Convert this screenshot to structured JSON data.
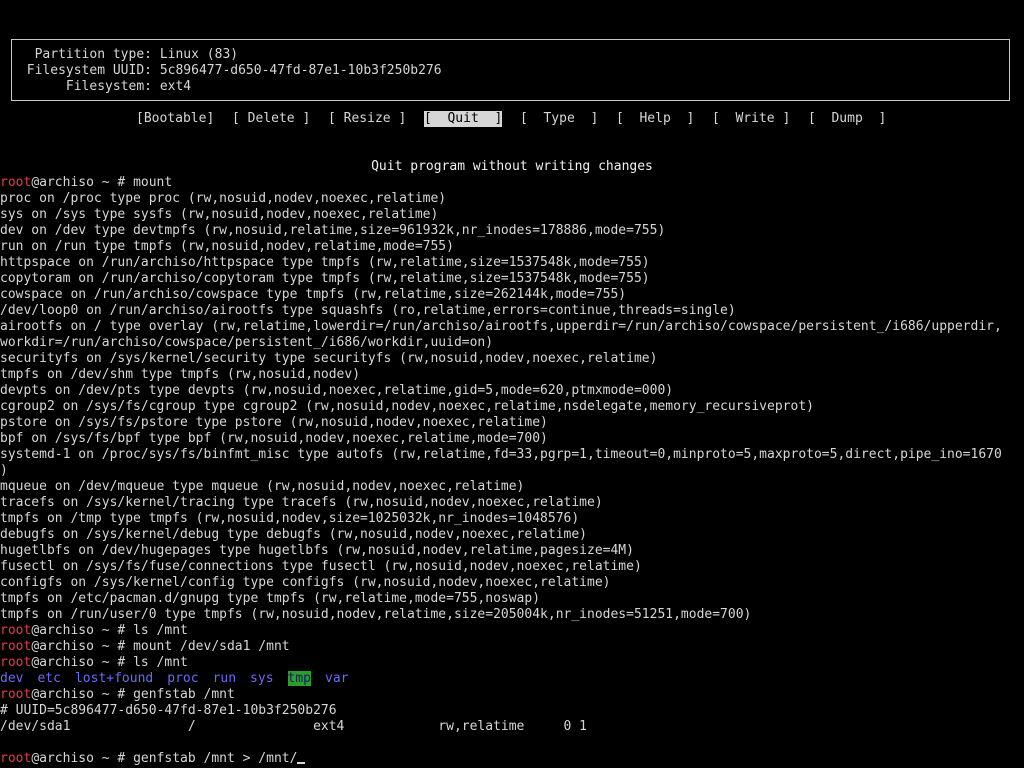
{
  "partition_info": {
    "type_label": "Partition type:",
    "type_value": "Linux (83)",
    "uuid_label": "Filesystem UUID:",
    "uuid_value": "5c896477-d650-47fd-87e1-10b3f250b276",
    "fs_label": "Filesystem:",
    "fs_value": "ext4"
  },
  "menu": {
    "bootable": "[Bootable]",
    "delete": "[ Delete ]",
    "resize": "[ Resize ]",
    "quit": "[  Quit  ]",
    "type": "[  Type  ]",
    "help": "[  Help  ]",
    "write": "[  Write ]",
    "dump": "[  Dump  ]",
    "selected": "quit"
  },
  "hint_text": "Quit program without writing changes",
  "prompt": {
    "user": "root",
    "rest": "@archiso ~ # "
  },
  "console": {
    "cmd_mount": "mount",
    "mount_output": [
      "proc on /proc type proc (rw,nosuid,nodev,noexec,relatime)",
      "sys on /sys type sysfs (rw,nosuid,nodev,noexec,relatime)",
      "dev on /dev type devtmpfs (rw,nosuid,relatime,size=961932k,nr_inodes=178886,mode=755)",
      "run on /run type tmpfs (rw,nosuid,nodev,relatime,mode=755)",
      "httpspace on /run/archiso/httpspace type tmpfs (rw,relatime,size=1537548k,mode=755)",
      "copytoram on /run/archiso/copytoram type tmpfs (rw,relatime,size=1537548k,mode=755)",
      "cowspace on /run/archiso/cowspace type tmpfs (rw,relatime,size=262144k,mode=755)",
      "/dev/loop0 on /run/archiso/airootfs type squashfs (ro,relatime,errors=continue,threads=single)",
      "airootfs on / type overlay (rw,relatime,lowerdir=/run/archiso/airootfs,upperdir=/run/archiso/cowspace/persistent_/i686/upperdir,",
      "workdir=/run/archiso/cowspace/persistent_/i686/workdir,uuid=on)",
      "securityfs on /sys/kernel/security type securityfs (rw,nosuid,nodev,noexec,relatime)",
      "tmpfs on /dev/shm type tmpfs (rw,nosuid,nodev)",
      "devpts on /dev/pts type devpts (rw,nosuid,noexec,relatime,gid=5,mode=620,ptmxmode=000)",
      "cgroup2 on /sys/fs/cgroup type cgroup2 (rw,nosuid,nodev,noexec,relatime,nsdelegate,memory_recursiveprot)",
      "pstore on /sys/fs/pstore type pstore (rw,nosuid,nodev,noexec,relatime)",
      "bpf on /sys/fs/bpf type bpf (rw,nosuid,nodev,noexec,relatime,mode=700)",
      "systemd-1 on /proc/sys/fs/binfmt_misc type autofs (rw,relatime,fd=33,pgrp=1,timeout=0,minproto=5,maxproto=5,direct,pipe_ino=1670",
      ")",
      "mqueue on /dev/mqueue type mqueue (rw,nosuid,nodev,noexec,relatime)",
      "tracefs on /sys/kernel/tracing type tracefs (rw,nosuid,nodev,noexec,relatime)",
      "tmpfs on /tmp type tmpfs (rw,nosuid,nodev,size=1025032k,nr_inodes=1048576)",
      "debugfs on /sys/kernel/debug type debugfs (rw,nosuid,nodev,noexec,relatime)",
      "hugetlbfs on /dev/hugepages type hugetlbfs (rw,nosuid,nodev,relatime,pagesize=4M)",
      "fusectl on /sys/fs/fuse/connections type fusectl (rw,nosuid,nodev,noexec,relatime)",
      "configfs on /sys/kernel/config type configfs (rw,nosuid,nodev,noexec,relatime)",
      "tmpfs on /etc/pacman.d/gnupg type tmpfs (rw,relatime,mode=755,noswap)",
      "tmpfs on /run/user/0 type tmpfs (rw,nosuid,nodev,relatime,size=205004k,nr_inodes=51251,mode=700)"
    ],
    "cmd_ls1": "ls /mnt",
    "cmd_mount_sda": "mount /dev/sda1 /mnt",
    "cmd_ls2": "ls /mnt",
    "ls_entries": [
      "dev",
      "etc",
      "lost+found",
      "proc",
      "run",
      "sys",
      "tmp",
      "var"
    ],
    "cmd_genfstab": "genfstab /mnt",
    "fstab_comment": "# UUID=5c896477-d650-47fd-87e1-10b3f250b276",
    "fstab_line": "/dev/sda1               /               ext4            rw,relatime     0 1",
    "cmd_current": "genfstab /mnt > /mnt/"
  },
  "colors": {
    "background": "#000000",
    "text": "#d6d6d6",
    "prompt_user": "#e83a3a",
    "dir_entry": "#6a6af5",
    "highlight_dir": "#2aa02a"
  }
}
